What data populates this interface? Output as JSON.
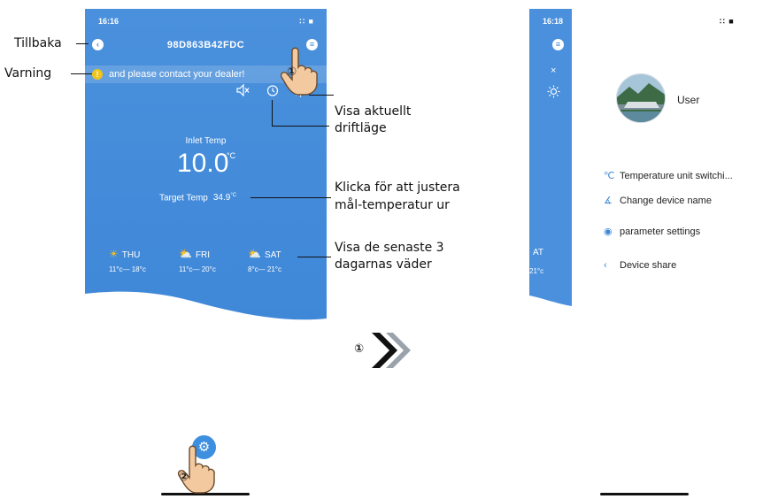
{
  "colors": {
    "app_blue": "#4a91dc",
    "accent_gold": "#f0c419",
    "annotation_text": "#111111"
  },
  "left_phone": {
    "status_time": "16:16",
    "status_icons": "∷ ■",
    "device_id": "98D863B42FDC",
    "back_glyph": "‹",
    "menu_glyph": "≡",
    "warning_text": "and please contact your dealer!",
    "warning_glyph": "!",
    "icons": {
      "mute": "mute-icon",
      "clock": "clock-icon",
      "mode": "sun-icon"
    },
    "inlet_label": "Inlet Temp",
    "inlet_value": "10.0",
    "inlet_unit": "°C",
    "target_label": "Target Temp",
    "target_value": "34.9",
    "target_unit": "°C",
    "weather": [
      {
        "day": "THU",
        "range": "11°c— 18°c",
        "icon": "sun-icon"
      },
      {
        "day": "FRI",
        "range": "11°c— 20°c",
        "icon": "partly-cloudy-icon"
      },
      {
        "day": "SAT",
        "range": "8°c— 21°c",
        "icon": "partly-cloudy-icon"
      }
    ],
    "settings_glyph": "⚙"
  },
  "annotations": {
    "back": "Tillbaka",
    "warning": "Varning",
    "mode_line1": "Visa aktuellt",
    "mode_line2": "driftläge",
    "target_line1": "Klicka för att justera",
    "target_line2": "mål-temperatur ur",
    "weather_line1": "Visa de senaste 3",
    "weather_line2": "dagarnas väder",
    "step1": "①",
    "step2": "②"
  },
  "right_phone": {
    "status_time": "16:18",
    "status_icons": "∷ ■",
    "menu_glyph": "≡",
    "close_glyph": "×",
    "partial_day": "AT",
    "partial_range": "21°c",
    "user_name": "User",
    "menu": [
      {
        "label": "Temperature unit switchi...",
        "glyph": "℃",
        "icon": "temperature-unit-icon"
      },
      {
        "label": "Change device name",
        "glyph": "∡",
        "icon": "edit-name-icon"
      },
      {
        "label": "parameter settings",
        "glyph": "◉",
        "icon": "parameter-icon"
      },
      {
        "label": "Device share",
        "glyph": "‹",
        "icon": "share-icon"
      }
    ]
  }
}
